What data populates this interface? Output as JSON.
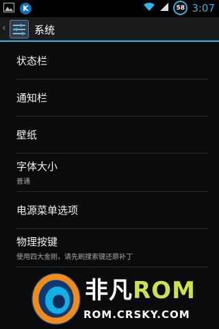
{
  "status_bar": {
    "icons": [
      "image-notification-icon",
      "k-app-icon",
      "wifi-icon",
      "signal-icon"
    ],
    "k_label": "K",
    "battery_level": "58",
    "time": "3:07",
    "accent": "#33b5e5"
  },
  "action_bar": {
    "title": "系统",
    "accent": "#33b5e5"
  },
  "list": [
    {
      "title": "状态栏"
    },
    {
      "title": "通知栏"
    },
    {
      "title": "壁纸"
    },
    {
      "title": "字体大小",
      "summary": "普通"
    },
    {
      "title": "电源菜单选项"
    },
    {
      "title": "物理按键",
      "summary": "使用四大金刚，请先刷搜索键还原补丁"
    }
  ],
  "watermark": {
    "brand_cn": "非凡",
    "brand_rom": "ROM",
    "url": "ROM.CRSKY.COM"
  }
}
